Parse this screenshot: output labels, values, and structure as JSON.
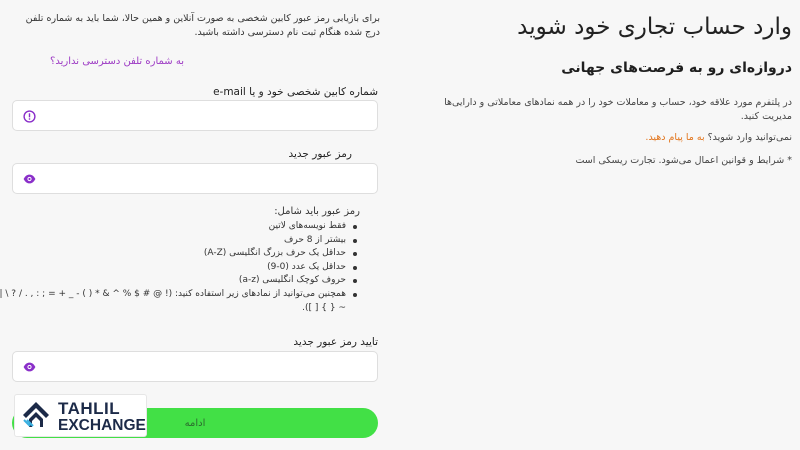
{
  "info": {
    "title": "وارد حساب تجاری خود شوید",
    "subtitle": "دروازه‌ای رو به فرصت‌های جهانی",
    "description": "در پلتفرم مورد علاقه خود، حساب و معاملات خود را در همه نمادهای معاملاتی و دارایی‌ها مدیریت کنید.",
    "login_help_question": "نمی‌توانید وارد شوید؟ ",
    "login_help_link": "به ما پیام دهید.",
    "terms": "* شرایط و قوانین اعمال می‌شود. تجارت ریسکی است"
  },
  "form": {
    "intro": "برای بازیابی رمز عبور کابین شخصی به صورت آنلاین و همین حالا، شما باید به شماره تلفن درج شده هنگام ثبت نام دسترسی داشته باشید.",
    "no_phone_link": "به شماره تلفن دسترسی ندارید؟",
    "cabinet_label": "شماره کابین شخصی خود و یا e-mail",
    "cabinet_value": "",
    "new_password_label": "رمز عبور جدید",
    "new_password_value": "",
    "requirements_title": "رمز عبور باید شامل:",
    "requirements": [
      "فقط نویسه‌های لاتین",
      "بیشتر از 8 حرف",
      "حداقل یک حرف بزرگ انگلیسی (A-Z)",
      "حداقل یک عدد (0-9)",
      "حروف کوچک انگلیسی (a-z)",
      "همچنین می‌توانید از نمادهای زیر استفاده کنید: (! @ # $ % ^ & * ( ) - _ + = ; : , . / ? \\ | ` ~ { } [ ])."
    ],
    "confirm_label": "تایید رمز عبور جدید",
    "confirm_value": "",
    "continue_label": "ادامه"
  },
  "logo": {
    "line1": "TAHLIL",
    "line2": "EXCHANGE"
  },
  "colors": {
    "accent_green": "#42e046",
    "link_purple": "#9d3bc4",
    "link_orange": "#e2741b",
    "icon_purple": "#8a2fc9"
  }
}
